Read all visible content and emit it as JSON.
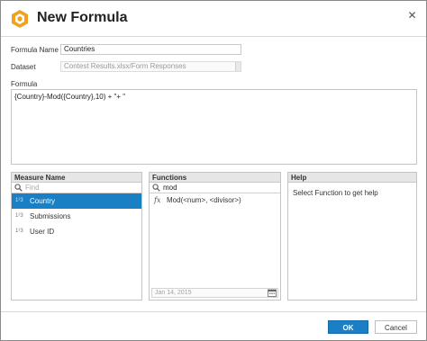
{
  "dialog": {
    "title": "New Formula"
  },
  "form": {
    "formula_name_label": "Formula Name",
    "formula_name_value": "Countries",
    "dataset_label": "Dataset",
    "dataset_value": "Contest Results.xlsx/Form Responses",
    "formula_label": "Formula",
    "formula_value": "{Country}-Mod({Country},10) + \"+ \""
  },
  "measure_panel": {
    "header": "Measure Name",
    "search_placeholder": "Find",
    "type_icon_text": "1²3",
    "items": [
      {
        "label": "Country",
        "selected": true
      },
      {
        "label": "Submissions",
        "selected": false
      },
      {
        "label": "User ID",
        "selected": false
      }
    ]
  },
  "functions_panel": {
    "header": "Functions",
    "search_value": "mod",
    "fx_symbol": "fx",
    "items": [
      {
        "label": "Mod(<num>, <divisor>)"
      }
    ],
    "date_value": "Jan 14, 2015"
  },
  "help_panel": {
    "header": "Help",
    "text": "Select Function to get help"
  },
  "footer": {
    "ok_label": "OK",
    "cancel_label": "Cancel"
  },
  "colors": {
    "accent": "#1a7fc5",
    "app_icon": "#f0a21c"
  }
}
